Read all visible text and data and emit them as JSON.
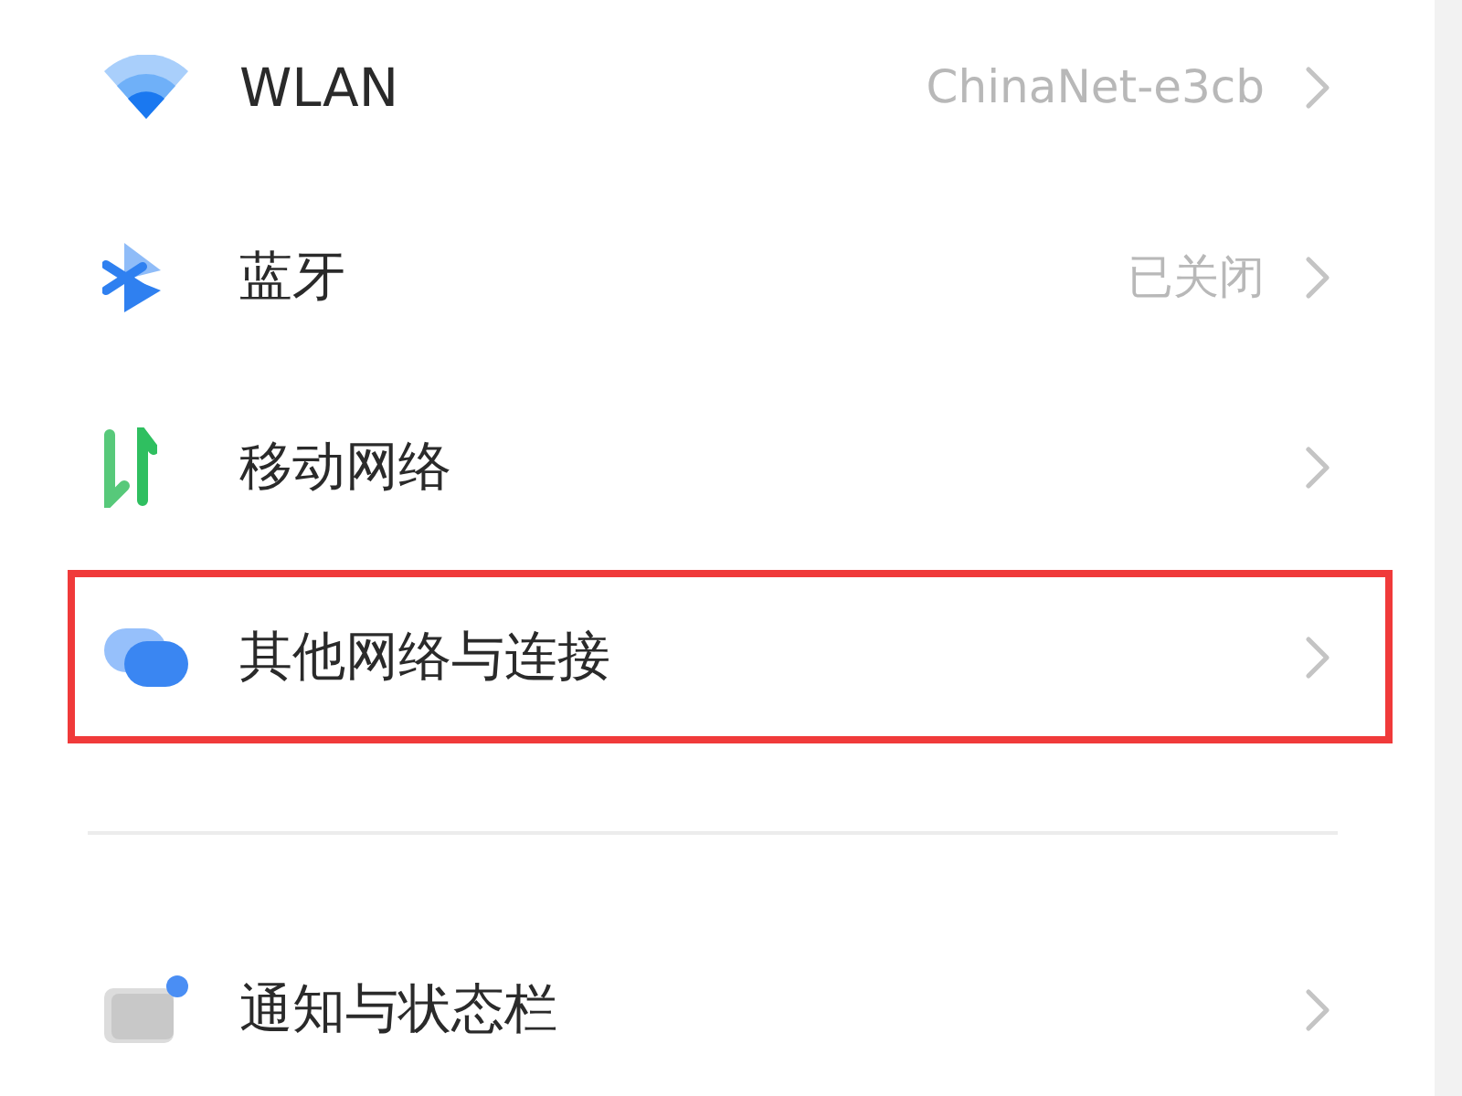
{
  "groups": [
    {
      "items": [
        {
          "kind": "wifi",
          "label": "WLAN",
          "value": "ChinaNet-e3cb",
          "highlighted": false
        },
        {
          "kind": "bluetooth",
          "label": "蓝牙",
          "value": "已关闭",
          "highlighted": false
        },
        {
          "kind": "mobile",
          "label": "移动网络",
          "highlighted": false
        },
        {
          "kind": "connections",
          "label": "其他网络与连接",
          "highlighted": true
        }
      ]
    },
    {
      "items": [
        {
          "kind": "notifications",
          "label": "通知与状态栏",
          "highlighted": false
        }
      ]
    }
  ]
}
